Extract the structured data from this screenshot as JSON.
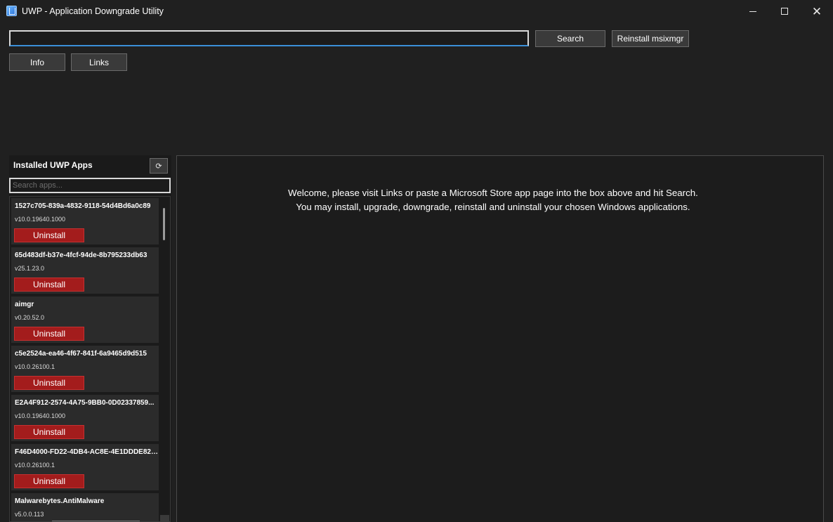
{
  "window": {
    "title": "UWP - Application Downgrade Utility",
    "icon": "app-package-icon"
  },
  "toolbar": {
    "url_value": "",
    "search_label": "Search",
    "reinstall_label": "Reinstall msixmgr",
    "info_label": "Info",
    "links_label": "Links"
  },
  "sidebar": {
    "title": "Installed UWP Apps",
    "refresh_icon": "refresh-icon",
    "refresh_glyph": "⟳",
    "search_placeholder": "Search apps...",
    "uninstall_label": "Uninstall",
    "apps": [
      {
        "name": "1527c705-839a-4832-9118-54d4Bd6a0c89",
        "version": "v10.0.19640.1000"
      },
      {
        "name": "65d483df-b37e-4fcf-94de-8b795233db63",
        "version": "v25.1.23.0"
      },
      {
        "name": "aimgr",
        "version": "v0.20.52.0"
      },
      {
        "name": "c5e2524a-ea46-4f67-841f-6a9465d9d515",
        "version": "v10.0.26100.1"
      },
      {
        "name": "E2A4F912-2574-4A75-9BB0-0D02337859...",
        "version": "v10.0.19640.1000"
      },
      {
        "name": "F46D4000-FD22-4DB4-AC8E-4E1DDDE828...",
        "version": "v10.0.26100.1"
      },
      {
        "name": "Malwarebytes.AntiMalware",
        "version": "v5.0.0.113"
      }
    ]
  },
  "main": {
    "welcome_line1": "Welcome, please visit Links or paste a Microsoft Store app page into the box above and hit Search.",
    "welcome_line2": "You may install, upgrade, downgrade, reinstall and uninstall your chosen Windows applications."
  },
  "colors": {
    "background": "#202020",
    "uninstall": "#a31c1c",
    "input_focus": "#3a8fd8"
  }
}
